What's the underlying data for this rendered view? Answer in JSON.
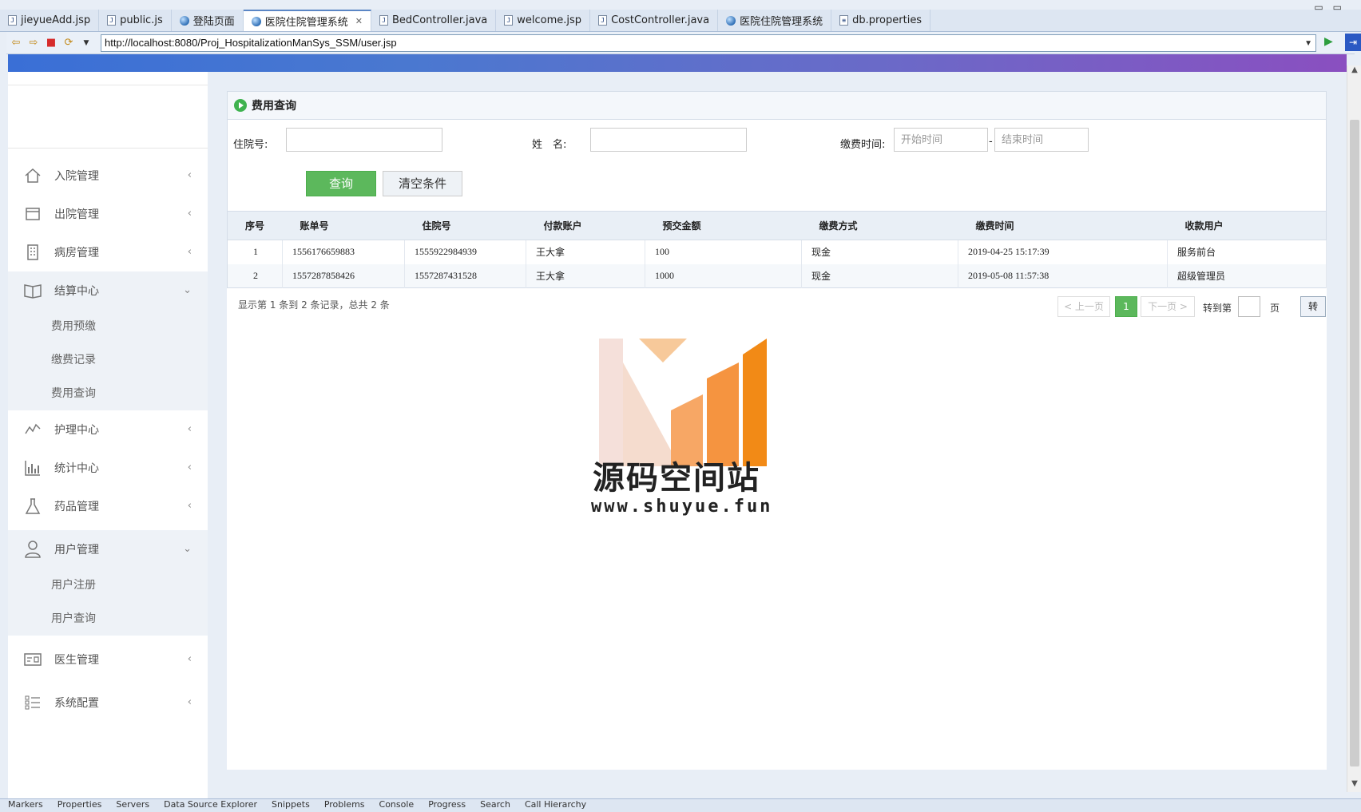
{
  "editor_tabs": [
    {
      "label": "jieyueAdd.jsp",
      "icon": "file-icon"
    },
    {
      "label": "public.js",
      "icon": "file-icon"
    },
    {
      "label": "登陆页面",
      "icon": "globe-icon"
    },
    {
      "label": "医院住院管理系统",
      "icon": "globe-icon",
      "active": true
    },
    {
      "label": "BedController.java",
      "icon": "file-icon"
    },
    {
      "label": "welcome.jsp",
      "icon": "file-icon"
    },
    {
      "label": "CostController.java",
      "icon": "file-icon"
    },
    {
      "label": "医院住院管理系统",
      "icon": "globe-icon"
    },
    {
      "label": "db.properties",
      "icon": "file-icon"
    }
  ],
  "browser": {
    "url": "http://localhost:8080/Proj_HospitalizationManSys_SSM/user.jsp"
  },
  "sidebar": {
    "items": [
      {
        "label": "入院管理",
        "icon": "home-icon"
      },
      {
        "label": "出院管理",
        "icon": "discharge-icon"
      },
      {
        "label": "病房管理",
        "icon": "building-icon"
      },
      {
        "label": "结算中心",
        "icon": "book-icon",
        "open": true,
        "children": [
          "费用预缴",
          "缴费记录",
          "费用查询"
        ]
      },
      {
        "label": "护理中心",
        "icon": "pulse-icon"
      },
      {
        "label": "统计中心",
        "icon": "bar-chart-icon"
      },
      {
        "label": "药品管理",
        "icon": "flask-icon"
      },
      {
        "label": "用户管理",
        "icon": "user-icon",
        "open": true,
        "children": [
          "用户注册",
          "用户查询"
        ]
      },
      {
        "label": "医生管理",
        "icon": "id-card-icon"
      },
      {
        "label": "系统配置",
        "icon": "list-icon"
      }
    ]
  },
  "panel": {
    "title": "费用查询"
  },
  "form": {
    "inpatient_label": "住院号:",
    "name_label": "姓　名:",
    "time_label": "缴费时间:",
    "start_placeholder": "开始时间",
    "end_placeholder": "结束时间",
    "range_sep": "-",
    "query_label": "查询",
    "clear_label": "清空条件"
  },
  "table": {
    "headers": [
      "序号",
      "账单号",
      "住院号",
      "付款账户",
      "预交金额",
      "缴费方式",
      "缴费时间",
      "收款用户"
    ],
    "rows": [
      [
        "1",
        "1556176659883",
        "1555922984939",
        "王大拿",
        "100",
        "现金",
        "2019-04-25 15:17:39",
        "服务前台"
      ],
      [
        "2",
        "1557287858426",
        "1557287431528",
        "王大拿",
        "1000",
        "现金",
        "2019-05-08 11:57:38",
        "超级管理员"
      ]
    ]
  },
  "pager": {
    "info": "显示第 1 条到 2 条记录，总共 2 条",
    "prev": "< 上一页",
    "current": "1",
    "next": "下一页 >",
    "goto_label": "转到第",
    "page_unit": "页",
    "go": "转"
  },
  "watermark": {
    "title": "源码空间站",
    "url": "www.shuyue.fun"
  },
  "bottom_tabs": [
    "Markers",
    "Properties",
    "Servers",
    "Data Source Explorer",
    "Snippets",
    "Problems",
    "Console",
    "Progress",
    "Search",
    "Call Hierarchy"
  ],
  "colors": {
    "accent_green": "#5cb85c",
    "header_gradient_start": "#3a6fd6",
    "header_gradient_end": "#8a4fc0"
  }
}
